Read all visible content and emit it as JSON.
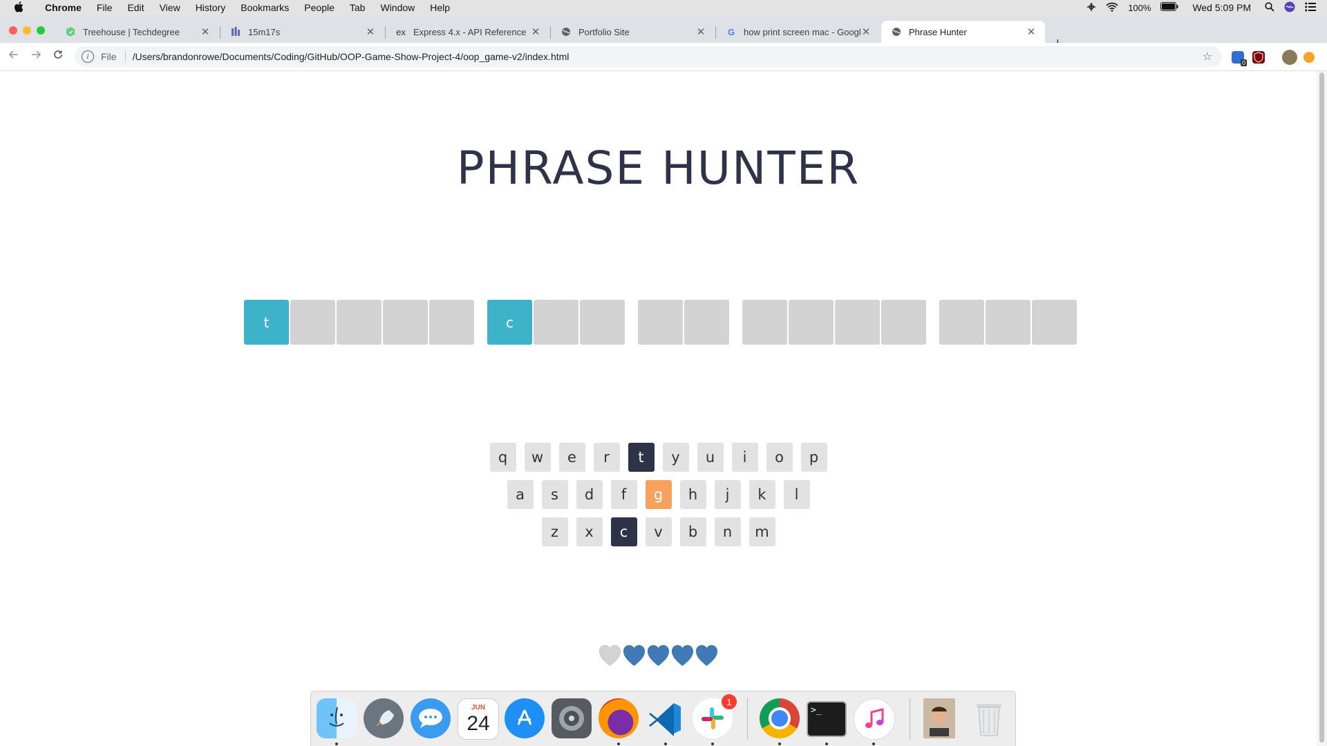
{
  "menubar": {
    "app_name": "Chrome",
    "menus": [
      "File",
      "Edit",
      "View",
      "History",
      "Bookmarks",
      "People",
      "Tab",
      "Window",
      "Help"
    ],
    "battery": "100%",
    "clock": "Wed 5:09 PM"
  },
  "tabs": [
    {
      "title": "Treehouse | Techdegree",
      "icon": "treehouse-icon"
    },
    {
      "title": "15m17s",
      "icon": "timer-icon"
    },
    {
      "title": "Express 4.x - API Reference",
      "icon": "express-icon",
      "icon_text": "ex"
    },
    {
      "title": "Portfolio Site",
      "icon": "globe-icon"
    },
    {
      "title": "how print screen mac - Google",
      "icon": "google-icon"
    },
    {
      "title": "Phrase Hunter",
      "icon": "globe-icon",
      "active": true
    }
  ],
  "address_bar": {
    "scheme_label": "File",
    "url": "/Users/brandonrowe/Documents/Coding/GitHub/OOP-Game-Show-Project-4/oop_game-v2/index.html"
  },
  "extensions": {
    "badge_count": "0"
  },
  "game": {
    "title": "PHRASE HUNTER",
    "phrase_words": [
      [
        {
          "char": "t",
          "shown": true
        },
        {
          "char": "",
          "shown": false
        },
        {
          "char": "",
          "shown": false
        },
        {
          "char": "",
          "shown": false
        },
        {
          "char": "",
          "shown": false
        }
      ],
      [
        {
          "char": "c",
          "shown": true
        },
        {
          "char": "",
          "shown": false
        },
        {
          "char": "",
          "shown": false
        }
      ],
      [
        {
          "char": "",
          "shown": false
        },
        {
          "char": "",
          "shown": false
        }
      ],
      [
        {
          "char": "",
          "shown": false
        },
        {
          "char": "",
          "shown": false
        },
        {
          "char": "",
          "shown": false
        },
        {
          "char": "",
          "shown": false
        }
      ],
      [
        {
          "char": "",
          "shown": false
        },
        {
          "char": "",
          "shown": false
        },
        {
          "char": "",
          "shown": false
        }
      ]
    ],
    "keyboard_rows": [
      [
        "q",
        "w",
        "e",
        "r",
        "t",
        "y",
        "u",
        "i",
        "o",
        "p"
      ],
      [
        "a",
        "s",
        "d",
        "f",
        "g",
        "h",
        "j",
        "k",
        "l"
      ],
      [
        "z",
        "x",
        "c",
        "v",
        "b",
        "n",
        "m"
      ]
    ],
    "chosen_keys": [
      "t",
      "c"
    ],
    "wrong_keys": [
      "g"
    ],
    "hearts": [
      {
        "state": "lost",
        "color": "#d3d3d3"
      },
      {
        "state": "live",
        "color": "#3f7ab6"
      },
      {
        "state": "live",
        "color": "#3f7ab6"
      },
      {
        "state": "live",
        "color": "#3f7ab6"
      },
      {
        "state": "live",
        "color": "#3f7ab6"
      }
    ],
    "colors": {
      "shown_letter": "#3cb3c8",
      "hidden_letter": "#d3d3d3",
      "chosen_key": "#2f3349",
      "wrong_key": "#f6a15c",
      "key": "#e2e2e2"
    }
  },
  "dock": {
    "apps": [
      {
        "name": "finder-icon",
        "running": true
      },
      {
        "name": "launchpad-icon",
        "running": false
      },
      {
        "name": "messages-icon",
        "running": false
      },
      {
        "name": "calendar-icon",
        "running": false,
        "month": "JUN",
        "day": "24"
      },
      {
        "name": "app-store-icon",
        "running": false
      },
      {
        "name": "system-preferences-icon",
        "running": false
      },
      {
        "name": "firefox-icon",
        "running": true
      },
      {
        "name": "vscode-icon",
        "running": true
      },
      {
        "name": "slack-icon",
        "running": true,
        "badge": "1"
      },
      {
        "name": "chrome-icon",
        "running": true
      },
      {
        "name": "terminal-icon",
        "running": true,
        "label": ">_"
      },
      {
        "name": "itunes-icon",
        "running": true
      },
      {
        "name": "user-photo-icon",
        "running": false
      },
      {
        "name": "trash-icon",
        "running": false
      }
    ]
  }
}
